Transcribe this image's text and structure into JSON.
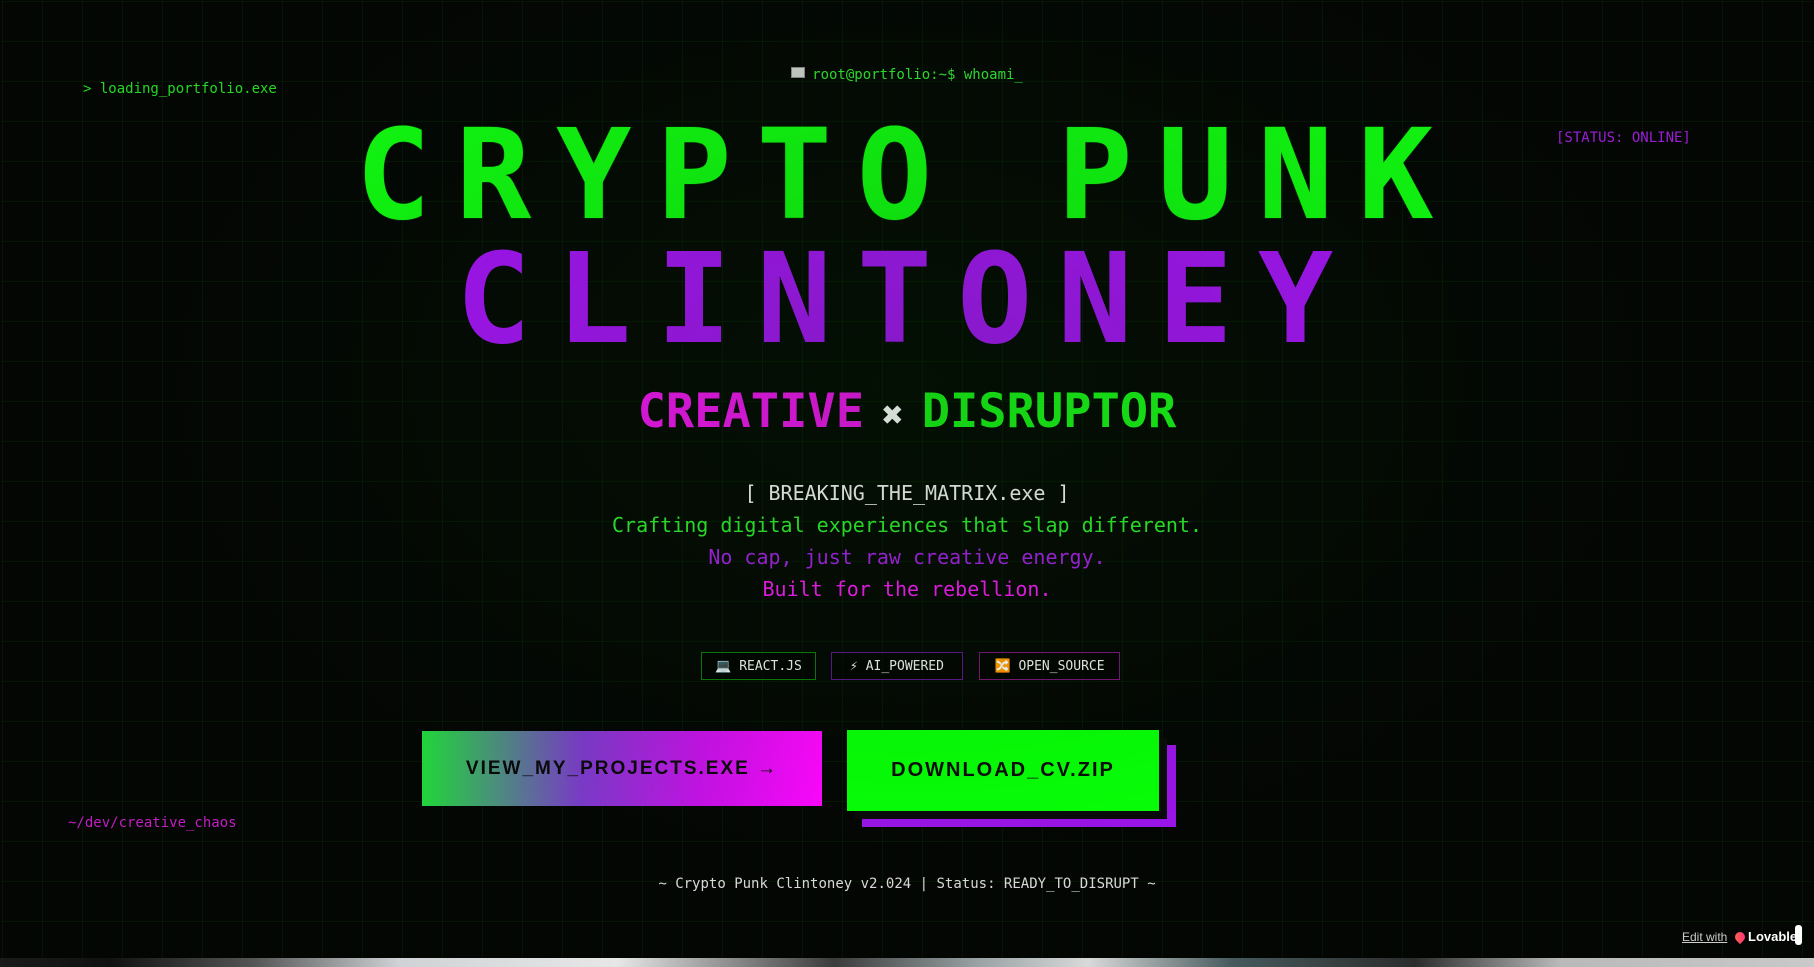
{
  "corners": {
    "top_left": "> loading_portfolio.exe",
    "top_right": "[STATUS: ONLINE]",
    "bottom_left": "~/dev/creative_chaos"
  },
  "prompt": {
    "icon": "terminal-icon",
    "text": "root@portfolio:~$ whoami_"
  },
  "hero": {
    "line1": "CRYPTO PUNK",
    "line2": "CLINTONEY",
    "subtitle_left": "CREATIVE",
    "subtitle_sep": "✖",
    "subtitle_right": "DISRUPTOR"
  },
  "tagline": {
    "exe": "[ BREAKING_THE_MATRIX.exe ]",
    "line1": "Crafting digital experiences that slap different.",
    "line2": "No cap, just raw creative energy.",
    "line3": "Built for the rebellion."
  },
  "chips": [
    {
      "icon": "💻",
      "label": "REACT.JS"
    },
    {
      "icon": "⚡",
      "label": "AI_POWERED"
    },
    {
      "icon": "🔀",
      "label": "OPEN_SOURCE"
    }
  ],
  "buttons": {
    "primary": "VIEW_MY_PROJECTS.EXE →",
    "secondary": "DOWNLOAD_CV.ZIP"
  },
  "footer": "~ Crypto Punk Clintoney v2.024 | Status: READY_TO_DISRUPT ~",
  "badge": {
    "edit_with": "Edit with",
    "brand": "Lovable"
  },
  "colors": {
    "neon_green": "#11f511",
    "neon_purple": "#a312f2",
    "neon_magenta": "#ee12ee",
    "background": "#040604"
  }
}
